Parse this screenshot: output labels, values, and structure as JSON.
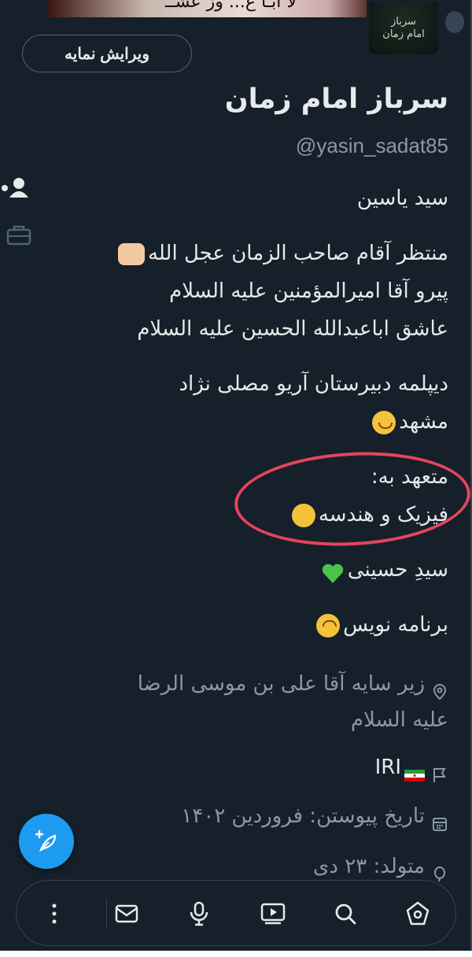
{
  "banner": {
    "text": "لا ابـا ع...  وز عشــ"
  },
  "avatar": {
    "line1": "سرباز",
    "line2": "امام زمان"
  },
  "profile": {
    "edit_button": "ویرایش نمایه",
    "display_name": "سرباز امام زمان",
    "handle": "@yasin_sadat85"
  },
  "bio": {
    "line_name": "سید یاسین",
    "line_wait": "منتظر آقام صاحب الزمان عجل الله",
    "line_follower": "پیرو آقا امیرالمؤمنین علیه السلام",
    "line_lover": "عاشق اباعبدالله الحسین علیه السلام",
    "line_diploma": "دیپلمه دبیرستان آریو مصلی نژاد",
    "line_city": "مشهد",
    "line_committed": "متعهد به:",
    "line_subjects": "فیزیک و هندسه",
    "line_sayed": "سیدِ حسینی",
    "line_programmer": "برنامه نویس"
  },
  "meta": {
    "location_line1": "زیر سایه آقا علی بن موسی الرضا",
    "location_line2": "علیه السلام",
    "country": "IRI",
    "joined": "تاریخ پیوستن: فروردین ۱۴۰۲",
    "born": "متولد: ۲۳ دی"
  },
  "colors": {
    "background": "#15202b",
    "accent": "#1d9bf0",
    "highlight_ring": "#e4455b",
    "text": "#e7e9ea",
    "muted": "#8b98a5"
  },
  "icons": {
    "location": "location-pin-icon",
    "country": "flag-icon",
    "joined": "calendar-icon",
    "born": "balloon-icon",
    "fab": "compose-feather-icon",
    "nav": [
      "more-vertical-icon",
      "mail-icon",
      "spaces-mic-icon",
      "video-icon",
      "search-icon",
      "home-icon"
    ]
  }
}
